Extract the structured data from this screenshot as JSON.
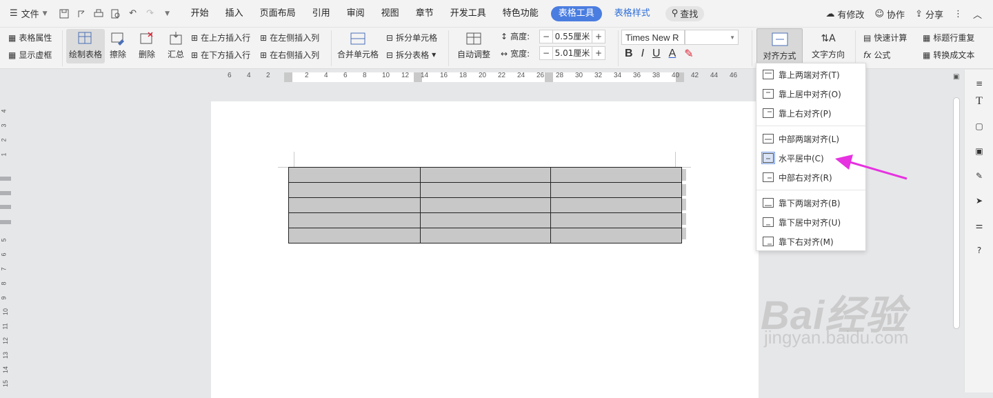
{
  "menubar": {
    "file_label": "文件",
    "tabs": [
      "开始",
      "插入",
      "页面布局",
      "引用",
      "审阅",
      "视图",
      "章节",
      "开发工具",
      "特色功能"
    ],
    "active_tab": "表格工具",
    "blue_tab": "表格样式",
    "search_label": "查找",
    "right": {
      "modified": "有修改",
      "collab": "协作",
      "share": "分享"
    }
  },
  "ribbon": {
    "table_props": "表格属性",
    "show_gridlines": "显示虚框",
    "draw_table": "绘制表格",
    "erase": "擦除",
    "delete": "删除",
    "summary": "汇总",
    "insert_above": "在上方插入行",
    "insert_below": "在下方插入行",
    "insert_left": "在左侧插入列",
    "insert_right": "在右侧插入列",
    "merge_cells": "合并单元格",
    "split_cells": "拆分单元格",
    "split_table": "拆分表格",
    "auto_fit": "自动调整",
    "height_label": "高度:",
    "height_value": "0.55厘米",
    "width_label": "宽度:",
    "width_value": "5.01厘米",
    "font_name": "Times New R",
    "bold": "B",
    "italic": "I",
    "underline": "U",
    "font_color": "A",
    "align_mode": "对齐方式",
    "text_direction": "文字方向",
    "quick_calc": "快速计算",
    "formula": "公式",
    "repeat_header": "标题行重复",
    "to_text": "转换成文本"
  },
  "ruler": {
    "h_ticks": [
      "6",
      "4",
      "2",
      "2",
      "4",
      "6",
      "8",
      "10",
      "12",
      "14",
      "16",
      "18",
      "20",
      "22",
      "24",
      "26",
      "28",
      "30",
      "32",
      "34",
      "36",
      "38",
      "40",
      "42",
      "44",
      "46"
    ],
    "v_ticks": [
      "4",
      "3",
      "2",
      "1",
      "5",
      "6",
      "7",
      "8",
      "9",
      "10",
      "11",
      "12",
      "13",
      "14",
      "15"
    ]
  },
  "align_menu": {
    "items": [
      {
        "label": "靠上两端对齐(T)",
        "icon": "align-top-justify-icon"
      },
      {
        "label": "靠上居中对齐(O)",
        "icon": "align-top-center-icon"
      },
      {
        "label": "靠上右对齐(P)",
        "icon": "align-top-right-icon"
      },
      {
        "label": "中部两端对齐(L)",
        "icon": "align-middle-justify-icon"
      },
      {
        "label": "水平居中(C)",
        "icon": "align-middle-center-icon"
      },
      {
        "label": "中部右对齐(R)",
        "icon": "align-middle-right-icon"
      },
      {
        "label": "靠下两端对齐(B)",
        "icon": "align-bottom-justify-icon"
      },
      {
        "label": "靠下居中对齐(U)",
        "icon": "align-bottom-center-icon"
      },
      {
        "label": "靠下右对齐(M)",
        "icon": "align-bottom-right-icon"
      }
    ],
    "highlighted": "水平居中(C)"
  },
  "watermark": {
    "brand": "Bai经验",
    "url": "jingyan.baidu.com"
  },
  "colors": {
    "accent": "#4a7de0",
    "arrow": "#e632e0",
    "cell_fill": "#c8c8c8"
  }
}
